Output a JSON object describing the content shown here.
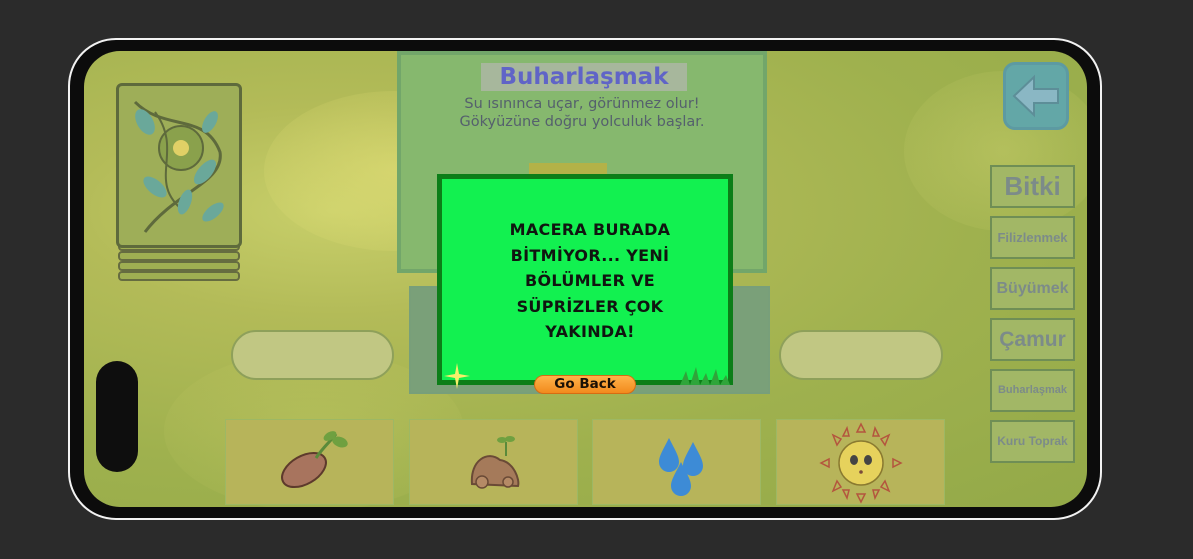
{
  "info_card": {
    "title": "Buharlaşmak",
    "desc_line1": "Su ısınınca uçar, görünmez olur!",
    "desc_line2": "Gökyüzüne doğru yolculuk başlar."
  },
  "side_menu": [
    {
      "label": "Bitki"
    },
    {
      "label": "Filizlenmek"
    },
    {
      "label": "Büyümek"
    },
    {
      "label": "Çamur"
    },
    {
      "label": "Buharlaşmak"
    },
    {
      "label": "Kuru Toprak"
    }
  ],
  "tiles": [
    {
      "icon": "seed-icon"
    },
    {
      "icon": "soil-sprout-icon"
    },
    {
      "icon": "water-drops-icon"
    },
    {
      "icon": "sun-icon"
    }
  ],
  "modal": {
    "message": "MACERA BURADA BİTMİYOR... YENİ BÖLÜMLER VE SÜPRİZLER ÇOK YAKINDA!",
    "button_label": "Go Back"
  },
  "colors": {
    "modal_bg": "#12f150",
    "modal_border": "#0c7e18",
    "button_orange": "#f28a1d",
    "title_purple": "#6064c7"
  }
}
